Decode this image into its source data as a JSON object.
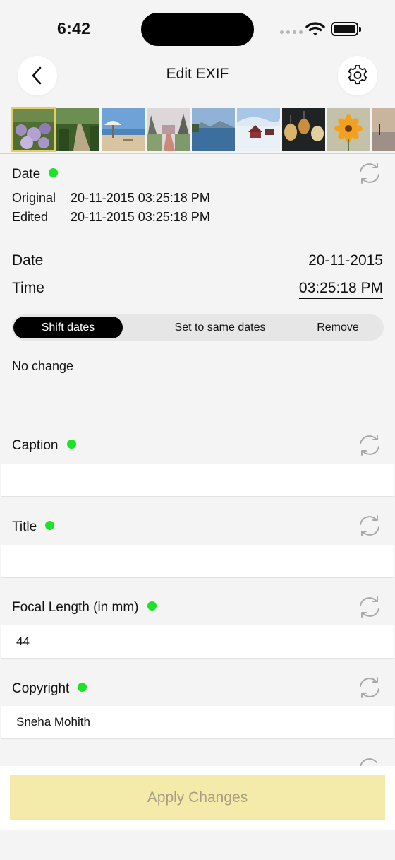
{
  "status": {
    "time": "6:42"
  },
  "nav": {
    "title": "Edit EXIF"
  },
  "thumbnails": [
    {
      "icon": "flowers-garden-photo",
      "selected": true
    },
    {
      "icon": "forest-path-photo",
      "selected": false
    },
    {
      "icon": "beach-umbrella-photo",
      "selected": false
    },
    {
      "icon": "tree-walkway-photo",
      "selected": false
    },
    {
      "icon": "lake-mountain-photo",
      "selected": false
    },
    {
      "icon": "snow-cabin-photo",
      "selected": false
    },
    {
      "icon": "lanterns-photo",
      "selected": false
    },
    {
      "icon": "yellow-flower-photo",
      "selected": false
    },
    {
      "icon": "sunset-beach-photo",
      "selected": false
    }
  ],
  "date_section": {
    "label": "Date",
    "original_label": "Original",
    "original_value": "20-11-2015 03:25:18 PM",
    "edited_label": "Edited",
    "edited_value": "20-11-2015 03:25:18 PM",
    "date_label": "Date",
    "date_value": "20-11-2015",
    "time_label": "Time",
    "time_value": "03:25:18 PM",
    "modes": [
      "Shift dates",
      "Set to same dates",
      "Remove"
    ],
    "active_mode": "Shift dates",
    "status_text": "No change"
  },
  "fields": [
    {
      "label": "Caption",
      "value": ""
    },
    {
      "label": "Title",
      "value": ""
    },
    {
      "label": "Focal Length (in mm)",
      "value": "44"
    },
    {
      "label": "Copyright",
      "value": "Sneha Mohith"
    }
  ],
  "footer": {
    "apply_label": "Apply Changes"
  },
  "colors": {
    "status_dot": "#1be325",
    "apply_bg": "#f4eaaa",
    "selected_border": "#e1ce64"
  }
}
